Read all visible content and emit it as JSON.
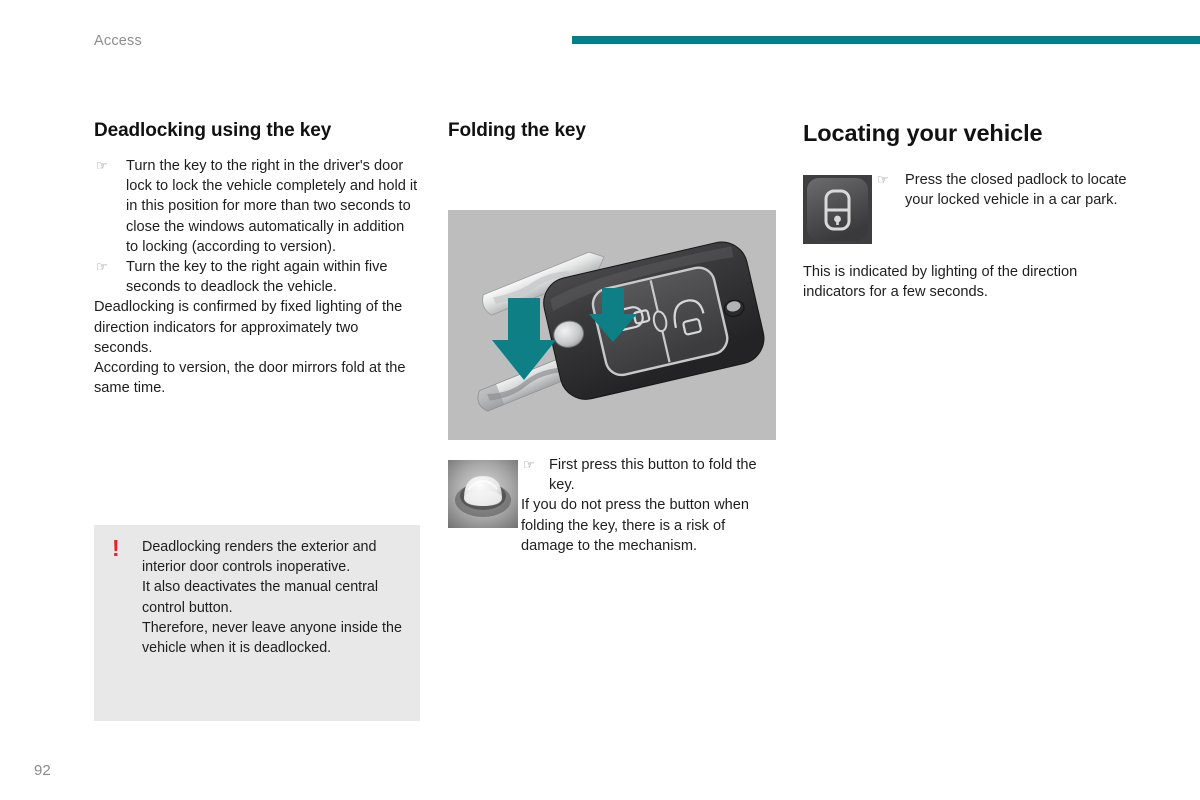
{
  "header": {
    "running_head": "Access",
    "rule_color": "#00808a"
  },
  "columns": {
    "deadlocking": {
      "heading": "Deadlocking using the key",
      "bullets": [
        {
          "glyph": "☞",
          "text": "Turn the key to the right in the driver's door lock to lock the vehicle completely and hold it in this position for more than two seconds to close the windows automatically in addition to locking (according to version)."
        },
        {
          "glyph": "☞",
          "text": "Turn the key to the right again within five seconds to deadlock the vehicle."
        }
      ],
      "paragraphs": [
        "Deadlocking is confirmed by fixed lighting of the direction indicators for approximately two seconds.",
        "According to version, the door mirrors fold at the same time."
      ]
    },
    "folding": {
      "heading": "Folding the key",
      "figure_name": "flip-key-illustration",
      "figure_background": "#bdbdbd",
      "arrow_color": "#0e7f85",
      "note_bullet_glyph": "☞",
      "note_bullet_text": "First press this button to fold the key.",
      "note_paragraph": "If you do not press the button when folding the key, there is a risk of damage to the mechanism."
    },
    "locating": {
      "heading": "Locating your vehicle",
      "figure_name": "closed-padlock-thumbnail",
      "bullet_glyph": "☞",
      "bullet_text": "Press the closed padlock to locate your locked vehicle in a car park.",
      "paragraph": "This is indicated by lighting of the direction indicators for a few seconds."
    }
  },
  "warning": {
    "icon_glyph": "!",
    "icon_color": "#e1252b",
    "background": "#e8e8e8",
    "lines": [
      "Deadlocking renders the exterior and interior door controls inoperative.",
      "It also deactivates the manual central control button.",
      "Therefore, never leave anyone inside the vehicle when it is deadlocked."
    ]
  },
  "footer": {
    "page_number": "92"
  }
}
